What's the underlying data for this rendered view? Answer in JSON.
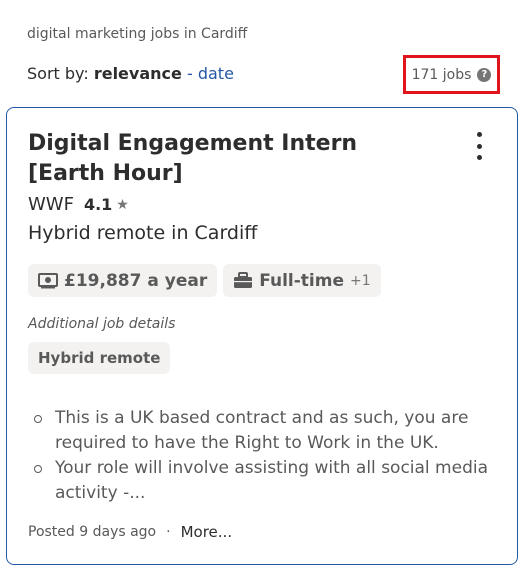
{
  "search": {
    "context": "digital marketing jobs in Cardiff"
  },
  "sort": {
    "label": "Sort by:",
    "current": "relevance",
    "separator": "-",
    "alternative": "date"
  },
  "results": {
    "count": "171 jobs",
    "help_icon": "question-circle-icon"
  },
  "job": {
    "title": "Digital Engagement Intern [Earth Hour]",
    "company": "WWF",
    "rating": "4.1",
    "rating_icon": "star-icon",
    "location": "Hybrid remote in Cardiff",
    "salary": "£19,887 a year",
    "salary_icon": "money-icon",
    "job_type": "Full-time",
    "job_type_icon": "briefcase-icon",
    "job_type_extra": "+1",
    "additional_label": "Additional job details",
    "additional_tag": "Hybrid remote",
    "snippet": [
      "This is a UK based contract and as such, you are required to have the Right to Work in the UK.",
      "Your role will involve assisting with all social media activity -..."
    ],
    "posted": "Posted 9 days ago",
    "dot": "·",
    "more": "More..."
  },
  "colors": {
    "accent": "#2557a7",
    "highlight": "#e0141c",
    "chip_bg": "#f3f2f1"
  }
}
